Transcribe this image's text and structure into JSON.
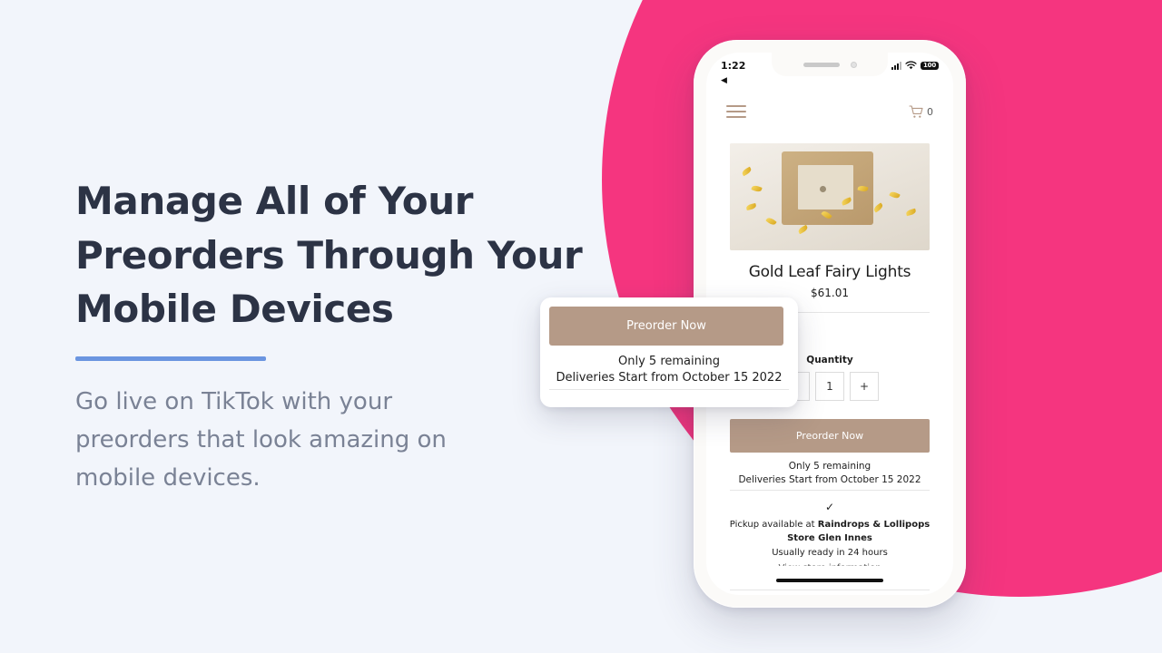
{
  "hero": {
    "headline_lines": [
      "Manage All of Your",
      "Preorders Through Your",
      "Mobile Devices"
    ],
    "subcopy": "Go live on TikTok with your preorders that look amazing on mobile devices.",
    "accent_color": "#6b95e0",
    "background_color": "#f2f5fb",
    "blob_color": "#f5357f"
  },
  "phone": {
    "status_bar": {
      "time": "1:22",
      "battery_level": "100",
      "signal_icon": "cellular-bars-icon",
      "wifi_icon": "wifi-icon",
      "battery_icon": "battery-icon",
      "back_arrow_icon": "back-arrow-icon"
    },
    "app_bar": {
      "menu_icon": "hamburger-menu-icon",
      "cart_icon": "shopping-cart-icon",
      "cart_count": "0"
    },
    "product": {
      "image_alt": "gold-leaf-fairy-lights-photo",
      "title": "Gold Leaf Fairy Lights",
      "price": "$61.01",
      "quantity_label": "Quantity",
      "quantity_decrement": "-",
      "quantity_value": "1",
      "quantity_increment": "+",
      "preorder_button": "Preorder Now",
      "stock_line": "Only 5 remaining",
      "delivery_line": "Deliveries Start from October 15 2022",
      "button_color": "#b59a87"
    },
    "pickup": {
      "check_icon": "checkmark-icon",
      "prefix": "Pickup available at ",
      "store_name": "Raindrops & Lollipops Store Glen Innes",
      "ready_text": "Usually ready in 24 hours",
      "more_info": "View store information"
    },
    "home_indicator": "home-indicator"
  },
  "float_card": {
    "preorder_button": "Preorder Now",
    "stock_line": "Only 5 remaining",
    "delivery_line": "Deliveries Start from October 15 2022"
  }
}
